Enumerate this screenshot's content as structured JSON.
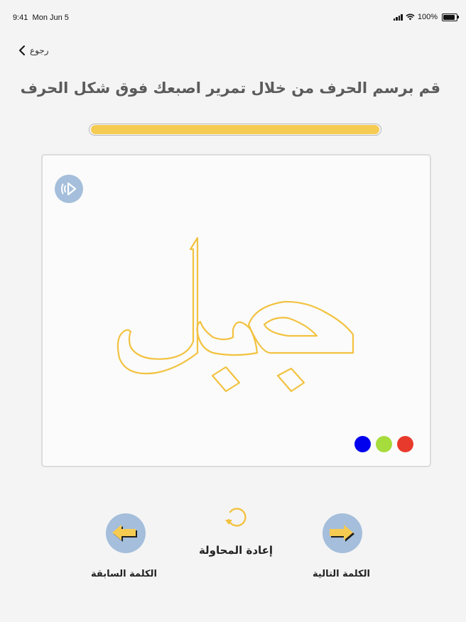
{
  "status_bar": {
    "time": "9:41",
    "date": "Mon Jun 5",
    "battery": "100%",
    "icons": [
      "signal-icon",
      "wifi-icon",
      "battery-icon"
    ]
  },
  "nav": {
    "back_label": "رجوع",
    "back_icon": "chevron-left-icon"
  },
  "instruction": "قم برسم الحرف من خلال تمرير اصبعك فوق شكل الحرف",
  "progress": {
    "value": 1.0,
    "fill_color": "#f6cb52"
  },
  "canvas": {
    "word": "جبل",
    "outline_color": "#f2c240",
    "sound_icon": "sound-play-icon",
    "pen_colors": [
      "#0000ee",
      "#a6dc3c",
      "#e83a2c"
    ]
  },
  "controls": {
    "previous_label": "الكلمة السابقة",
    "next_label": "الكلمة التالية",
    "retry_label": "إعادة المحاولة",
    "previous_icon": "arrow-left-icon",
    "next_icon": "arrow-right-icon",
    "retry_icon": "retry-icon",
    "accent": "#f6cb52",
    "circle_color": "#a4bedb"
  }
}
